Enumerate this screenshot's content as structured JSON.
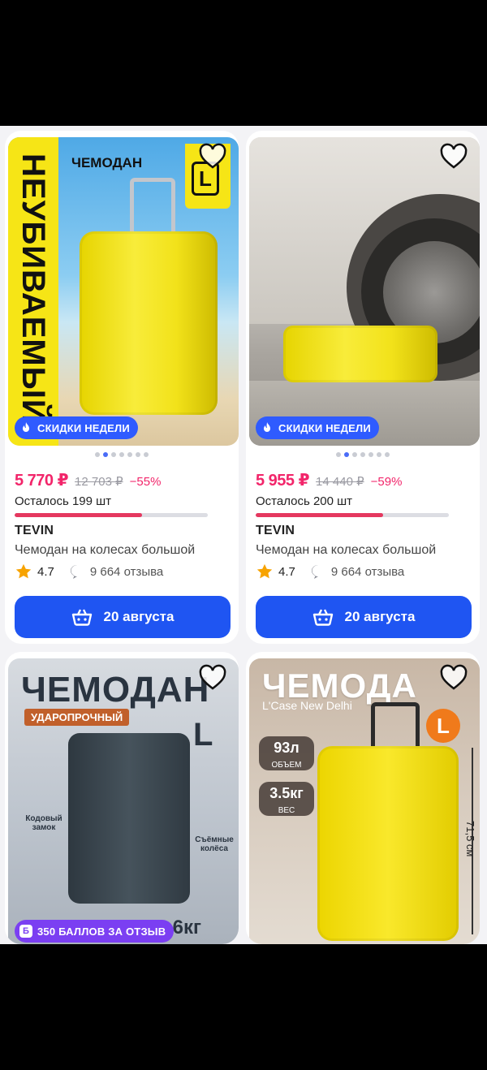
{
  "colors": {
    "accent": "#1f55f2",
    "price": "#f2256a",
    "badge_blue": "#2f5bff",
    "badge_purple": "#7b3ff2",
    "stock_bar": "#e5385f"
  },
  "products": [
    {
      "image_texts": {
        "vertical": "НЕУБИВАЕМЫЙ",
        "label": "ЧЕМОДАН",
        "logo": "L"
      },
      "badge": "СКИДКИ НЕДЕЛИ",
      "badge_icon": "fire-icon",
      "dots_count": 7,
      "dots_active": 1,
      "price": "5 770 ₽",
      "old_price": "12 703 ₽",
      "discount": "−55%",
      "stock": "Осталось 199 шт",
      "stock_fraction": 0.66,
      "brand": "TEVIN",
      "title": "Чемодан на колесах большой",
      "rating": "4.7",
      "reviews": "9 664 отзыва",
      "delivery": "20 августа"
    },
    {
      "badge": "СКИДКИ НЕДЕЛИ",
      "badge_icon": "fire-icon",
      "dots_count": 7,
      "dots_active": 1,
      "price": "5 955 ₽",
      "old_price": "14 440 ₽",
      "discount": "−59%",
      "stock": "Осталось 200 шт",
      "stock_fraction": 0.66,
      "brand": "TEVIN",
      "title": "Чемодан на колесах большой",
      "rating": "4.7",
      "reviews": "9 664 отзыва",
      "delivery": "20 августа"
    },
    {
      "image_texts": {
        "big": "ЧЕМОДАН",
        "tag": "УДАРОПРОЧНЫЙ",
        "size": "L",
        "left_feature": "Кодовый замок",
        "right_feature": "Съёмные колёса",
        "weight": ",6кг"
      },
      "badge": "350 БАЛЛОВ ЗА ОТЗЫВ",
      "badge_icon": "points-icon"
    },
    {
      "image_texts": {
        "big": "ЧЕМОДА",
        "sub": "L'Case New Delhi",
        "size": "L",
        "volume_value": "93л",
        "volume_label": "ОБЪЕМ",
        "weight_value": "3.5кг",
        "weight_label": "ВЕС",
        "height": "71,5 см"
      }
    }
  ]
}
